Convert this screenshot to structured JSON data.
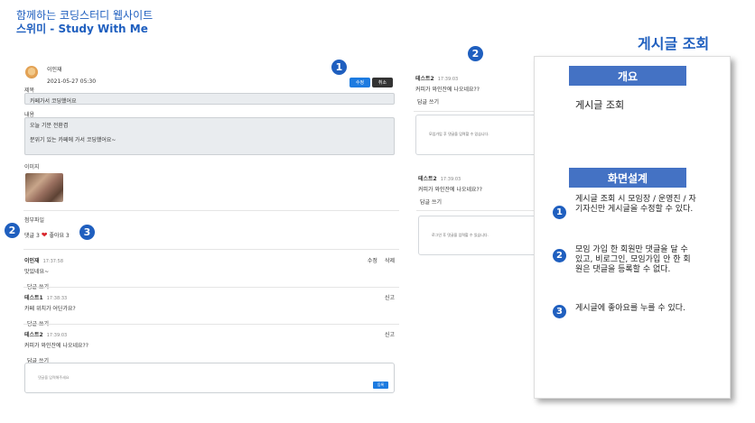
{
  "header": {
    "title_line1": "함께하는 코딩스터디 웹사이트",
    "title_line2": "스위미 - Study With Me"
  },
  "page_title": "게시글 조회",
  "post": {
    "author": "이인재",
    "date": "2021-05-27 05:30",
    "edit_label": "수정",
    "cancel_label": "취소",
    "title_label": "제목",
    "title_value": "카페가서 코딩했어요",
    "content_label": "내용",
    "content_line1": "오늘 기분 전환겸",
    "content_line2": "분위기 있는 카페에 가서 코딩했어요~",
    "image_label": "이미지",
    "attachment_label": "첨부파일",
    "comment_count_label": "댓글 3",
    "like_label": "좋아요 3",
    "comments": [
      {
        "name": "이인재",
        "time": "17:37:58",
        "text": "맛있네요~",
        "reply": "답글 쓰기",
        "edit": "수정",
        "delete": "삭제"
      },
      {
        "name": "테스트1",
        "time": "17:38:33",
        "text": "카페 위치가 어딘가요?",
        "reply": "답글 쓰기",
        "report": "신고"
      },
      {
        "name": "테스트2",
        "time": "17:39:03",
        "text": "커피가 와인잔에 나오네요??",
        "reply": "답글 쓰기",
        "report": "신고"
      }
    ],
    "comment_placeholder": "댓글을 입력해주세요",
    "submit_label": "등록"
  },
  "mid_top": {
    "name": "테스트2",
    "time": "17:39:03",
    "text": "커피가 와인잔에 나오네요??",
    "reply": "답글 쓰기",
    "notice": "모임가입 후 댓글을 입력할 수 있습니다."
  },
  "mid_bottom": {
    "name": "테스트2",
    "time": "17:39:03",
    "text": "커피가 와인잔에 나오네요??",
    "reply": "답글 쓰기",
    "notice": "로그인 후 댓글을 입력할 수 있습니다."
  },
  "markers": [
    "1",
    "2",
    "3"
  ],
  "panel": {
    "overview_tag": "개요",
    "overview_text": "게시글 조회",
    "design_tag": "화면설계",
    "desc1": "게시글 조회 시 모임장 / 운영진 / 자기자신만 게시글을 수정할 수 있다.",
    "desc2": "모임 가입 한 회원만 댓글을 달 수 있고, 비로그인, 모임가입 안 한 회원은 댓글을 등록할 수 없다.",
    "desc3": "게시글에 좋아요를 누를 수 있다."
  },
  "colors": {
    "accent": "#1f5fbf",
    "tag": "#4472c4",
    "edit_button": "#1d7be0",
    "heart": "#d9262c"
  }
}
